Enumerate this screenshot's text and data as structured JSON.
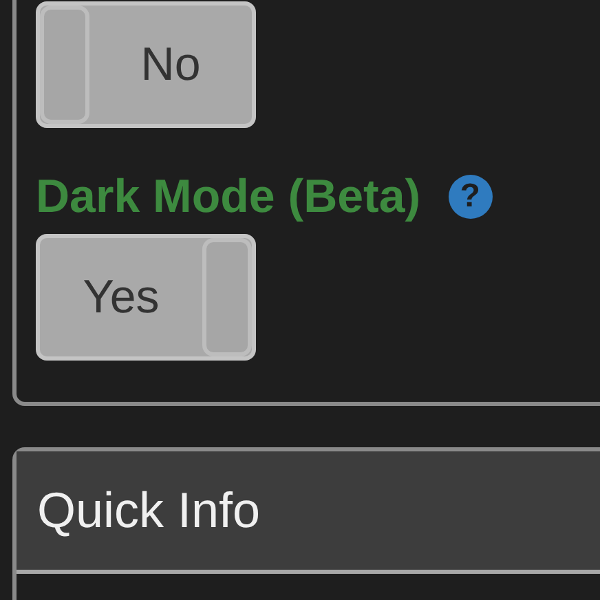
{
  "settings": [
    {
      "toggle": {
        "text": "No",
        "on": false
      }
    },
    {
      "label": "Dark Mode (Beta)",
      "help_icon": "?",
      "toggle": {
        "text": "Yes",
        "on": true
      }
    }
  ],
  "quick_info": {
    "title": "Quick Info"
  }
}
